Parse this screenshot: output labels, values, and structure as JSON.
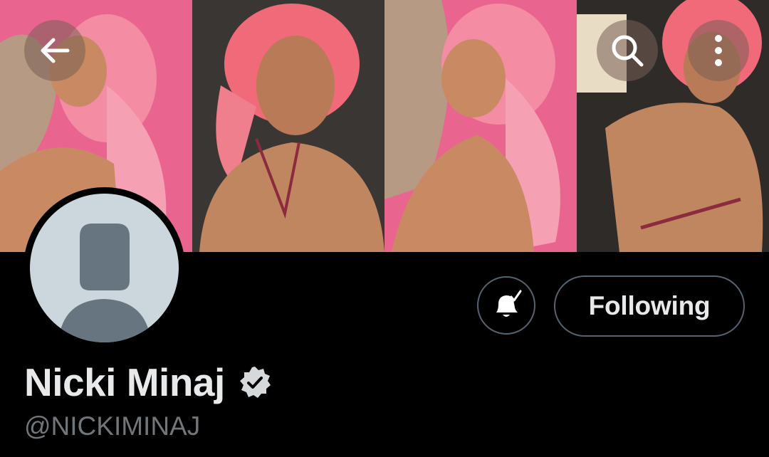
{
  "header": {
    "icons": {
      "back": "arrow-left-icon",
      "search": "search-icon",
      "more": "more-vertical-icon"
    }
  },
  "banner": {
    "panel_count": 4,
    "colors": {
      "pink_background": "#e9658f",
      "hair": "#f48ca3",
      "skin": "#c98a63",
      "dark_background": "#3a3633"
    }
  },
  "profile": {
    "display_name": "Nicki Minaj",
    "handle": "@NICKIMINAJ",
    "verified": true,
    "avatar": "default-avatar-icon",
    "notifications_icon": "bell-check-icon",
    "follow_button_label": "Following"
  },
  "theme": {
    "background": "#000000",
    "text_primary": "#e7e9ea",
    "text_secondary": "#71767b",
    "border": "#536471"
  }
}
